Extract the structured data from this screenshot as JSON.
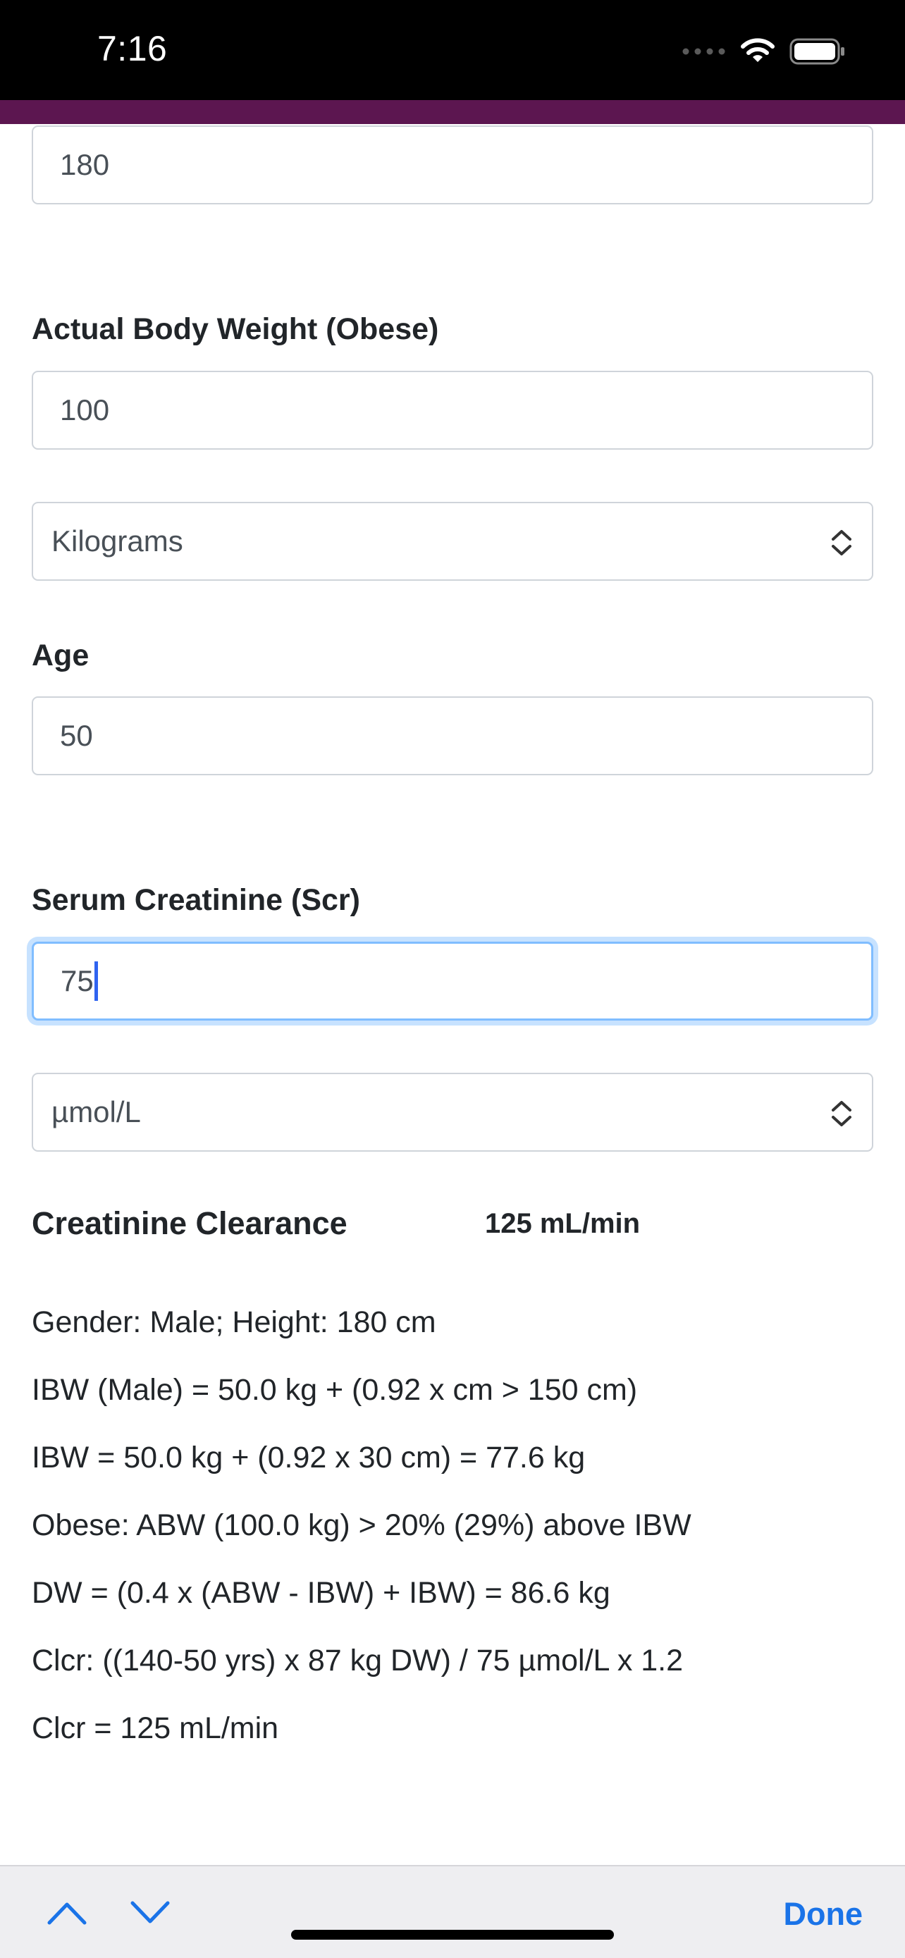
{
  "status_bar": {
    "time": "7:16",
    "icons": [
      "cellular-dots-icon",
      "wifi-icon",
      "battery-icon"
    ]
  },
  "colors": {
    "header_band": "#5c1650",
    "focus_ring": "#80bdff",
    "done_blue": "#1a73e8",
    "nav_arrow_blue": "#1a73e8"
  },
  "form": {
    "height_value": "180",
    "weight_label": "Actual Body Weight (Obese)",
    "weight_value": "100",
    "weight_unit": "Kilograms",
    "age_label": "Age",
    "age_value": "50",
    "scr_label": "Serum Creatinine (Scr)",
    "scr_value": "75",
    "scr_unit": "µmol/L"
  },
  "result": {
    "label": "Creatinine Clearance",
    "value": "125 mL/min"
  },
  "calculation_lines": [
    "Gender: Male; Height: 180 cm",
    "IBW (Male) = 50.0 kg + (0.92 x cm > 150 cm)",
    "IBW = 50.0 kg + (0.92 x 30 cm) = 77.6 kg",
    "Obese: ABW (100.0 kg) > 20% (29%) above IBW",
    "DW = (0.4 x (ABW - IBW) + IBW) = 86.6 kg",
    "Clcr: ((140-50 yrs) x 87 kg DW) / 75 µmol/L x 1.2",
    "Clcr = 125 mL/min"
  ],
  "keyboard_bar": {
    "done_label": "Done",
    "nav_icons": [
      "chevron-up-icon",
      "chevron-down-icon"
    ]
  }
}
